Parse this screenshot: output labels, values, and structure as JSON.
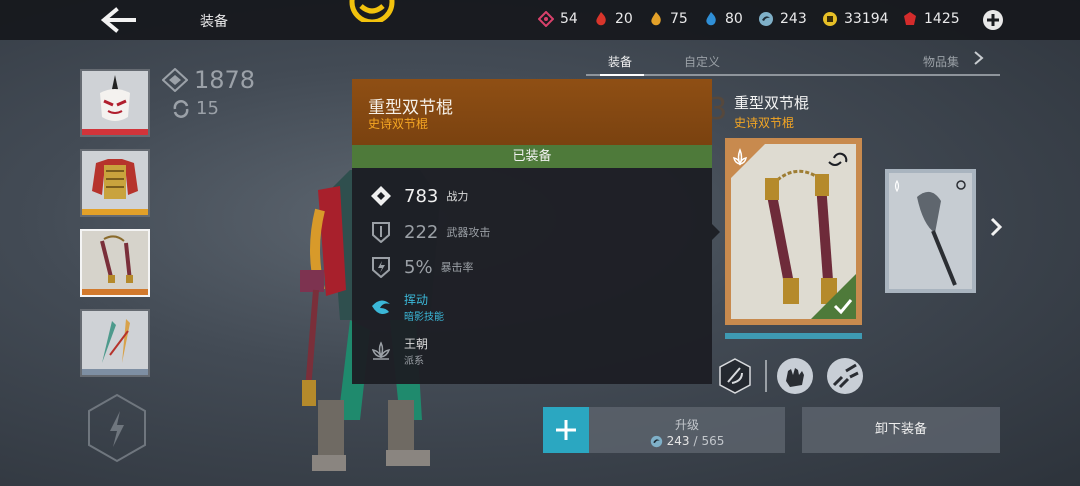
{
  "header": {
    "title": "装备",
    "currencies": [
      {
        "icon": "pink-gem-icon",
        "value": "54",
        "color": "#d9416b"
      },
      {
        "icon": "red-flame-icon",
        "value": "20",
        "color": "#d8352b"
      },
      {
        "icon": "gold-flame-icon",
        "value": "75",
        "color": "#e3a129"
      },
      {
        "icon": "blue-flame-icon",
        "value": "80",
        "color": "#2f8fd6"
      },
      {
        "icon": "shadow-swirl-icon",
        "value": "243",
        "color": "#7fb0c8"
      },
      {
        "icon": "gold-coin-icon",
        "value": "33194",
        "color": "#e7c027"
      },
      {
        "icon": "ruby-icon",
        "value": "1425",
        "color": "#d32b2b"
      }
    ]
  },
  "tabs": {
    "equipment": "装备",
    "custom": "自定义",
    "item_set": "物品集"
  },
  "stats": {
    "power": "1878",
    "level": "15"
  },
  "ghost_power": "783",
  "slots": [
    {
      "name": "helmet",
      "bar_color": "#d2343a"
    },
    {
      "name": "armor",
      "bar_color": "#e3a129"
    },
    {
      "name": "weapon",
      "bar_color": "#d2792c"
    },
    {
      "name": "ranged",
      "bar_color": "#7e8fa3"
    }
  ],
  "panel": {
    "name": "重型双节棍",
    "rarity": "史诗双节棍",
    "equipped": "已装备",
    "power_value": "783",
    "power_label": "战力",
    "attack_value": "222",
    "attack_label": "武器攻击",
    "crit_value": "5%",
    "crit_label": "暴击率",
    "skill_name": "挥动",
    "skill_type": "暗影技能",
    "faction_name": "王朝",
    "faction_type": "派系"
  },
  "item": {
    "name": "重型双节棍",
    "rarity": "史诗双节棍"
  },
  "actions": {
    "upgrade_label": "升级",
    "upgrade_current": "243",
    "upgrade_max": "565",
    "unequip_label": "卸下装备"
  },
  "colors": {
    "epic": "#f5a623",
    "equipped_green": "#4e7a3a",
    "accent_cyan": "#2ba7c1",
    "panel_head": "#8f4f14"
  }
}
